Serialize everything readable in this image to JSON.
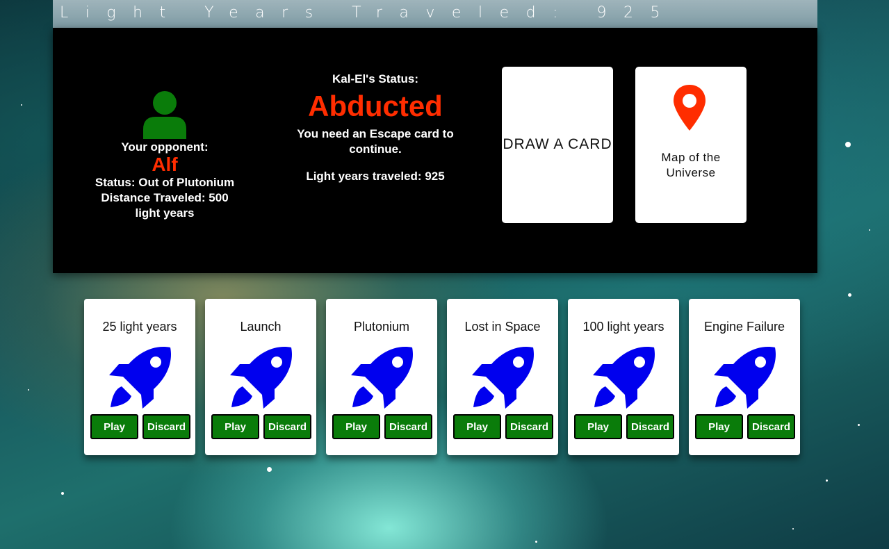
{
  "header": {
    "title": "Light Years Traveled: 925"
  },
  "opponent": {
    "label": "Your opponent:",
    "name": "Alf",
    "status": "Status: Out of Plutonium",
    "distance": "Distance Traveled: 500 light years"
  },
  "player_status": {
    "label": "Kal-El's Status:",
    "value": "Abducted",
    "message": "You need an Escape card to continue.",
    "light_years": "Light years traveled: 925"
  },
  "deck": {
    "draw_label": "DRAW A CARD"
  },
  "map": {
    "label": "Map of the Universe",
    "icon": "map-pin-icon"
  },
  "hand": {
    "play_label": "Play",
    "discard_label": "Discard",
    "card_icon": "rocket-icon",
    "cards": [
      {
        "title": "25 light years"
      },
      {
        "title": "Launch"
      },
      {
        "title": "Plutonium"
      },
      {
        "title": "Lost in Space"
      },
      {
        "title": "100 light years"
      },
      {
        "title": "Engine Failure"
      }
    ]
  },
  "colors": {
    "accent_red": "#ff2d00",
    "opponent_icon": "#0a7c0a",
    "button_green": "#0a7c0a",
    "rocket_blue": "#0000ee"
  }
}
